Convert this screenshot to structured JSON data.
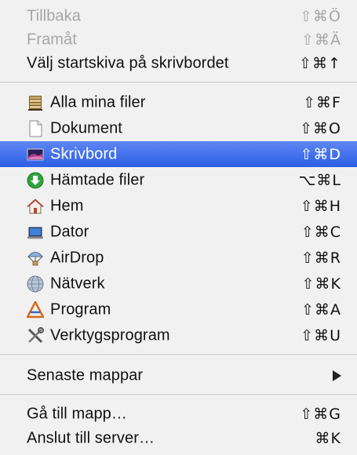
{
  "menu": {
    "nav": [
      {
        "label": "Tillbaka",
        "shortcut": "⇧⌘Ö",
        "enabled": false
      },
      {
        "label": "Framåt",
        "shortcut": "⇧⌘Ä",
        "enabled": false
      },
      {
        "label": "Välj startskiva på skrivbordet",
        "shortcut": "⇧⌘↑",
        "enabled": true
      }
    ],
    "places": [
      {
        "label": "Alla mina filer",
        "shortcut": "⇧⌘F",
        "icon": "all-my-files-icon"
      },
      {
        "label": "Dokument",
        "shortcut": "⇧⌘O",
        "icon": "document-icon"
      },
      {
        "label": "Skrivbord",
        "shortcut": "⇧⌘D",
        "icon": "desktop-icon",
        "selected": true
      },
      {
        "label": "Hämtade filer",
        "shortcut": "⌥⌘L",
        "icon": "downloads-icon"
      },
      {
        "label": "Hem",
        "shortcut": "⇧⌘H",
        "icon": "home-icon"
      },
      {
        "label": "Dator",
        "shortcut": "⇧⌘C",
        "icon": "computer-icon"
      },
      {
        "label": "AirDrop",
        "shortcut": "⇧⌘R",
        "icon": "airdrop-icon"
      },
      {
        "label": "Nätverk",
        "shortcut": "⇧⌘K",
        "icon": "network-icon"
      },
      {
        "label": "Program",
        "shortcut": "⇧⌘A",
        "icon": "applications-icon"
      },
      {
        "label": "Verktygsprogram",
        "shortcut": "⇧⌘U",
        "icon": "utilities-icon"
      }
    ],
    "recent": {
      "label": "Senaste mappar",
      "icon": "submenu-arrow-icon"
    },
    "goto": [
      {
        "label": "Gå till mapp…",
        "shortcut": "⇧⌘G"
      },
      {
        "label": "Anslut till server…",
        "shortcut": "⌘K"
      }
    ],
    "colors": {
      "selection": "#3a6cea",
      "disabled_text": "#a6a6a6",
      "background": "#f1f1f1"
    }
  }
}
